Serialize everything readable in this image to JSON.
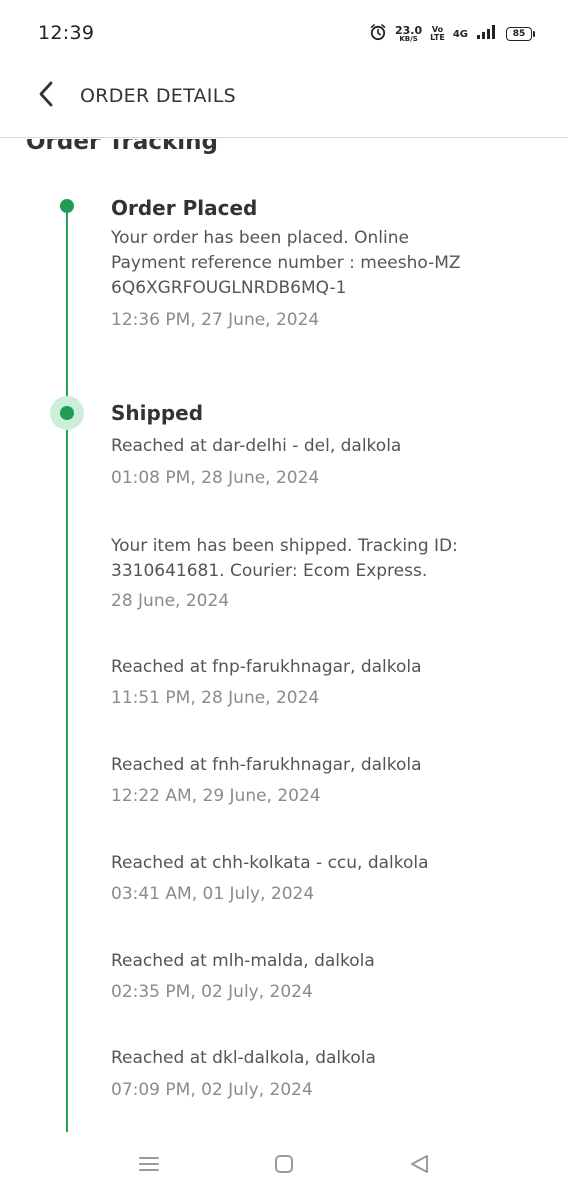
{
  "status_bar": {
    "time": "12:39",
    "net_speed": "23.0",
    "net_unit": "KB/S",
    "volte_top": "Vo",
    "volte_bottom": "LTE",
    "network": "4G",
    "battery": "85",
    "icons": [
      "alarm-icon",
      "volte-icon",
      "network-4g-icon",
      "signal-icon",
      "battery-icon"
    ]
  },
  "header": {
    "back_icon": "back-chevron-icon",
    "title": "ORDER DETAILS"
  },
  "tracking": {
    "section_title": "Order Tracking",
    "accent_color": "#1f9d55",
    "stages": [
      {
        "title": "Order Placed",
        "events": [
          {
            "lines": [
              "Your order has been placed. Online",
              "Payment reference number : meesho-MZ",
              "6Q6XGRFOUGLNRDB6MQ-1"
            ],
            "time": "12:36 PM, 27 June, 2024"
          }
        ]
      },
      {
        "title": "Shipped",
        "events": [
          {
            "lines": [
              "Reached at dar-delhi - del, dalkola"
            ],
            "time": "01:08 PM, 28 June, 2024"
          },
          {
            "lines": [
              "Your item has been shipped. Tracking ID:",
              "3310641681. Courier: Ecom Express."
            ],
            "time": "28 June, 2024"
          },
          {
            "lines": [
              "Reached at fnp-farukhnagar, dalkola"
            ],
            "time": "11:51 PM, 28 June, 2024"
          },
          {
            "lines": [
              "Reached at fnh-farukhnagar, dalkola"
            ],
            "time": "12:22 AM, 29 June, 2024"
          },
          {
            "lines": [
              "Reached at chh-kolkata - ccu, dalkola"
            ],
            "time": "03:41 AM, 01 July, 2024"
          },
          {
            "lines": [
              "Reached at mlh-malda, dalkola"
            ],
            "time": "02:35 PM, 02 July, 2024"
          },
          {
            "lines": [
              "Reached at dkl-dalkola, dalkola"
            ],
            "time": "07:09 PM, 02 July, 2024"
          }
        ]
      }
    ]
  },
  "nav_bar": {
    "icons": [
      "menu-icon",
      "home-icon",
      "back-triangle-icon"
    ]
  }
}
